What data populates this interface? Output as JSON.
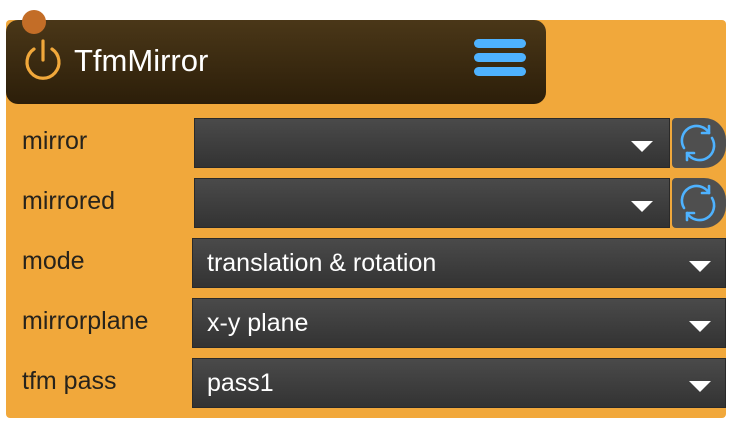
{
  "header": {
    "title": "TfmMirror",
    "power_icon": "power-icon",
    "menu_icon": "hamburger-menu-icon"
  },
  "rows": [
    {
      "label": "mirror",
      "value": "",
      "has_refresh": true
    },
    {
      "label": "mirrored",
      "value": "",
      "has_refresh": true
    },
    {
      "label": "mode",
      "value": "translation & rotation",
      "has_refresh": false
    },
    {
      "label": "mirrorplane",
      "value": "x-y plane",
      "has_refresh": false
    },
    {
      "label": "tfm pass",
      "value": "pass1",
      "has_refresh": false
    }
  ],
  "colors": {
    "panel_bg": "#f1a83b",
    "header_bg": "#3a2a12",
    "accent_orange": "#f1a83b",
    "accent_blue": "#4eb2ff",
    "select_bg": "#3d3d3d",
    "label_text": "#27231c"
  },
  "icons": {
    "refresh": "refresh-icon",
    "dropdown": "chevron-down-icon"
  }
}
